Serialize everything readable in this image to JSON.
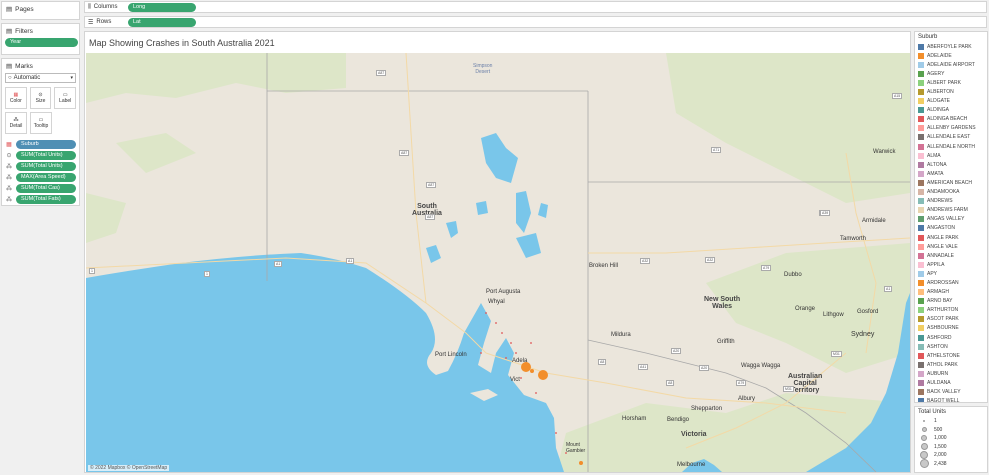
{
  "pages": {
    "title": "Pages"
  },
  "filters": {
    "title": "Filters",
    "pill": "Year"
  },
  "marks": {
    "title": "Marks",
    "type": "Automatic",
    "buttons": [
      "Color",
      "Size",
      "Label",
      "Detail",
      "Tooltip"
    ],
    "fields": [
      "Suburb",
      "SUM(Total Units)",
      "SUM(Total Units)",
      "MAX(Area Speed)",
      "SUM(Total Cas)",
      "SUM(Total Fats)"
    ]
  },
  "columns": {
    "label": "Columns",
    "pill": "Long"
  },
  "rows": {
    "label": "Rows",
    "pill": "Lat"
  },
  "view": {
    "title": "Map Showing Crashes in South Australia 2021",
    "attribution": "© 2022 Mapbox © OpenStreetMap",
    "labels": {
      "simpson": "Simpson\nDesert",
      "sa": "South\nAustralia",
      "nsw": "New South\nWales",
      "act": "Australian\nCapital\nTerritory",
      "victoria": "Victoria",
      "port_augusta": "Port Augusta",
      "whyalla": "Whyal",
      "port_lincoln": "Port Lincoln",
      "adelaide": "Adela",
      "victor": "Vict",
      "broken_hill": "Broken Hill",
      "mildura": "Mildura",
      "griffith": "Griffith",
      "wagga": "Wagga Wagga",
      "albury": "Albury",
      "shepparton": "Shepparton",
      "bendigo": "Bendigo",
      "horsham": "Horsham",
      "melbourne": "Melbourne",
      "sydney": "Sydney",
      "dubbo": "Dubbo",
      "orange": "Orange",
      "tamworth": "Tamworth",
      "armidale": "Armidale",
      "warwick": "Warwick",
      "lithgow": "Lithgow",
      "gosford": "Gosford",
      "mount": "Mount\nGambier"
    },
    "roads": [
      "A87",
      "A87",
      "A87",
      "A87",
      "A1",
      "A1",
      "1",
      "1",
      "A71",
      "A15",
      "A32",
      "A39",
      "A32",
      "A41",
      "A20",
      "A79",
      "A20",
      "M31",
      "M31",
      "A39",
      "A1",
      "A8",
      "A8",
      "A79"
    ]
  },
  "color_legend": {
    "title": "Suburb",
    "items": [
      {
        "name": "ABERFOYLE PARK",
        "color": "#4e79a7"
      },
      {
        "name": "ADELAIDE",
        "color": "#f28e2b"
      },
      {
        "name": "ADELAIDE AIRPORT",
        "color": "#a0cbe8"
      },
      {
        "name": "AGERY",
        "color": "#59a14f"
      },
      {
        "name": "ALBERT PARK",
        "color": "#8cd17d"
      },
      {
        "name": "ALBERTON",
        "color": "#b6992d"
      },
      {
        "name": "ALDGATE",
        "color": "#f1ce63"
      },
      {
        "name": "ALDINGA",
        "color": "#499894"
      },
      {
        "name": "ALDINGA BEACH",
        "color": "#e15759"
      },
      {
        "name": "ALLENBY GARDENS",
        "color": "#ff9d9a"
      },
      {
        "name": "ALLENDALE EAST",
        "color": "#79706e"
      },
      {
        "name": "ALLENDALE NORTH",
        "color": "#d37295"
      },
      {
        "name": "ALMA",
        "color": "#fabfd2"
      },
      {
        "name": "ALTONA",
        "color": "#b07aa1"
      },
      {
        "name": "AMATA",
        "color": "#d4a6c8"
      },
      {
        "name": "AMERICAN BEACH",
        "color": "#9d7660"
      },
      {
        "name": "ANDAMOOKA",
        "color": "#d7b5a6"
      },
      {
        "name": "ANDREWS",
        "color": "#86bcb6"
      },
      {
        "name": "ANDREWS FARM",
        "color": "#e8d5b0"
      },
      {
        "name": "ANGAS VALLEY",
        "color": "#5f9e6e"
      },
      {
        "name": "ANGASTON",
        "color": "#4e79a7"
      },
      {
        "name": "ANGLE PARK",
        "color": "#e15759"
      },
      {
        "name": "ANGLE VALE",
        "color": "#ff9d9a"
      },
      {
        "name": "ANNADALE",
        "color": "#d37295"
      },
      {
        "name": "APPILA",
        "color": "#fabfd2"
      },
      {
        "name": "APY",
        "color": "#a0cbe8"
      },
      {
        "name": "ARDROSSAN",
        "color": "#f28e2b"
      },
      {
        "name": "ARMAGH",
        "color": "#ffbe7d"
      },
      {
        "name": "ARNO BAY",
        "color": "#59a14f"
      },
      {
        "name": "ARTHURTON",
        "color": "#8cd17d"
      },
      {
        "name": "ASCOT PARK",
        "color": "#b6992d"
      },
      {
        "name": "ASHBOURNE",
        "color": "#f1ce63"
      },
      {
        "name": "ASHFORD",
        "color": "#499894"
      },
      {
        "name": "ASHTON",
        "color": "#86bcb6"
      },
      {
        "name": "ATHELSTONE",
        "color": "#e15759"
      },
      {
        "name": "ATHOL PARK",
        "color": "#79706e"
      },
      {
        "name": "AUBURN",
        "color": "#d4a6c8"
      },
      {
        "name": "AULDANA",
        "color": "#b07aa1"
      },
      {
        "name": "BACK VALLEY",
        "color": "#9d7660"
      },
      {
        "name": "BAGOT WELL",
        "color": "#4e79a7"
      }
    ]
  },
  "size_legend": {
    "title": "Total Units",
    "items": [
      "1",
      "500",
      "1,000",
      "1,500",
      "2,000",
      "2,438"
    ]
  }
}
